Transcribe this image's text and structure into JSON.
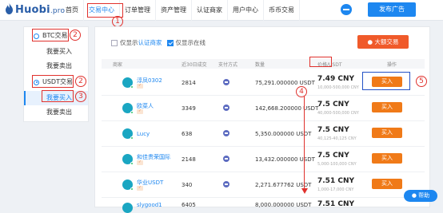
{
  "brand": {
    "name": "Huobi",
    "suffix": ".pro"
  },
  "nav": {
    "items": [
      "首页",
      "交易中心",
      "订单管理",
      "资产管理",
      "认证商家",
      "用户中心",
      "币币交易"
    ],
    "active_index": 1
  },
  "header": {
    "publish_label": "发布广告"
  },
  "annotations": {
    "n1": "1",
    "n2a": "2",
    "n2b": "2",
    "n3": "3",
    "n4": "4",
    "n5": "5"
  },
  "sidebar": {
    "btc": {
      "label": "BTC交易",
      "buy": "我要买入",
      "sell": "我要卖出"
    },
    "usdt": {
      "label": "USDT交易",
      "buy": "我要买入",
      "sell": "我要卖出"
    }
  },
  "filters": {
    "verified_prefix": "仅显示",
    "verified_link": "认证商家",
    "online_only": "仅显示在线",
    "big_trade": "大额交易"
  },
  "table": {
    "headers": [
      "商家",
      "近30日成交",
      "支付方式",
      "数量",
      "价格/USDT",
      "操作"
    ],
    "buy_label": "买入",
    "rows": [
      {
        "name": "淳凤0302",
        "count": "2814",
        "amount": "75,291.000000 USDT",
        "price": "7.49 CNY",
        "limit": "10,000-500,000 CNY",
        "badge": true
      },
      {
        "name": "欧菜人",
        "count": "3349",
        "amount": "142,668.200000 USDT",
        "price": "7.5 CNY",
        "limit": "40,000-500,000 CNY",
        "badge": true
      },
      {
        "name": "Lucy",
        "count": "638",
        "amount": "5,350.000000 USDT",
        "price": "7.5 CNY",
        "limit": "40,125-40,125 CNY",
        "badge": false
      },
      {
        "name": "和佳贵荣国际",
        "count": "2148",
        "amount": "13,432.000000 USDT",
        "price": "7.5 CNY",
        "limit": "5,000-100,000 CNY",
        "badge": true
      },
      {
        "name": "华业USDT",
        "count": "340",
        "amount": "2,271.677762 USDT",
        "price": "7.51 CNY",
        "limit": "1,000-17,000 CNY",
        "badge": true
      },
      {
        "name": "slygood1",
        "count": "6405",
        "amount": "8,000.000000 USDT",
        "price": "7.51 CNY",
        "limit": "",
        "badge": false
      }
    ]
  },
  "help": {
    "label": "帮助"
  },
  "colors": {
    "accent": "#1d87f0",
    "buy": "#f07a18",
    "big_trade": "#f05a2a",
    "annotation": "#e0312d"
  }
}
